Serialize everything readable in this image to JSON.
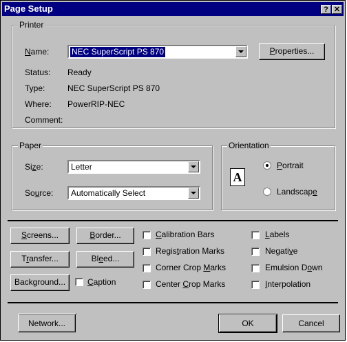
{
  "window": {
    "title": "Page Setup",
    "help_glyph": "?",
    "close_glyph": "✕"
  },
  "printer": {
    "legend": "Printer",
    "name_label": "Name:",
    "name_value": "NEC SuperScript PS 870",
    "properties_button": "Properties...",
    "status_label": "Status:",
    "status_value": "Ready",
    "type_label": "Type:",
    "type_value": "NEC SuperScript PS 870",
    "where_label": "Where:",
    "where_value": "PowerRIP-NEC",
    "comment_label": "Comment:",
    "comment_value": ""
  },
  "paper": {
    "legend": "Paper",
    "size_label": "Size:",
    "size_value": "Letter",
    "source_label": "Source:",
    "source_value": "Automatically Select"
  },
  "orientation": {
    "legend": "Orientation",
    "icon_letter": "A",
    "portrait_label": "Portrait",
    "landscape_label": "Landscape",
    "selected": "portrait"
  },
  "buttons": {
    "screens": "Screens...",
    "border": "Border...",
    "transfer": "Transfer...",
    "bleed": "Bleed...",
    "background": "Background...",
    "network": "Network...",
    "ok": "OK",
    "cancel": "Cancel"
  },
  "options": {
    "caption": "Caption",
    "calibration_bars": "Calibration Bars",
    "registration_marks": "Registration Marks",
    "corner_crop_marks": "Corner Crop Marks",
    "center_crop_marks": "Center Crop Marks",
    "labels": "Labels",
    "negative": "Negative",
    "emulsion_down": "Emulsion Down",
    "interpolation": "Interpolation"
  }
}
